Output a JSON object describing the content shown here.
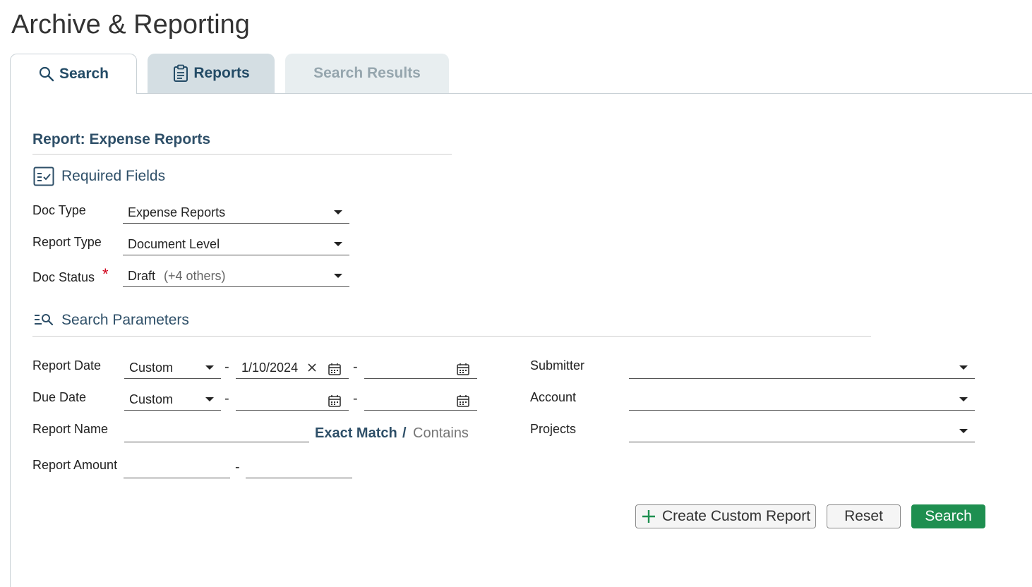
{
  "page": {
    "title": "Archive & Reporting"
  },
  "tabs": {
    "search": "Search",
    "reports": "Reports",
    "results": "Search Results"
  },
  "report": {
    "title": "Report: Expense Reports"
  },
  "required": {
    "heading": "Required Fields",
    "doc_type": {
      "label": "Doc Type",
      "value": "Expense Reports"
    },
    "report_type": {
      "label": "Report Type",
      "value": "Document Level"
    },
    "doc_status": {
      "label": "Doc Status",
      "required_mark": "*",
      "value": "Draft",
      "extra": "(+4 others)"
    }
  },
  "params": {
    "heading": "Search Parameters",
    "report_date": {
      "label": "Report Date",
      "mode": "Custom",
      "from": "1/10/2024",
      "to": ""
    },
    "due_date": {
      "label": "Due Date",
      "mode": "Custom",
      "from": "",
      "to": ""
    },
    "range_sep": "-",
    "report_name": {
      "label": "Report Name",
      "value": "",
      "exact": "Exact Match",
      "sep": "/",
      "contains": "Contains"
    },
    "report_amount": {
      "label": "Report Amount",
      "min": "",
      "max": ""
    },
    "submitter": {
      "label": "Submitter",
      "value": ""
    },
    "account": {
      "label": "Account",
      "value": ""
    },
    "projects": {
      "label": "Projects",
      "value": ""
    }
  },
  "buttons": {
    "create_custom": "Create Custom Report",
    "reset": "Reset",
    "search": "Search"
  },
  "colors": {
    "accent": "#2e4f68",
    "primary_button": "#1e8f50",
    "required": "#d0021b"
  }
}
